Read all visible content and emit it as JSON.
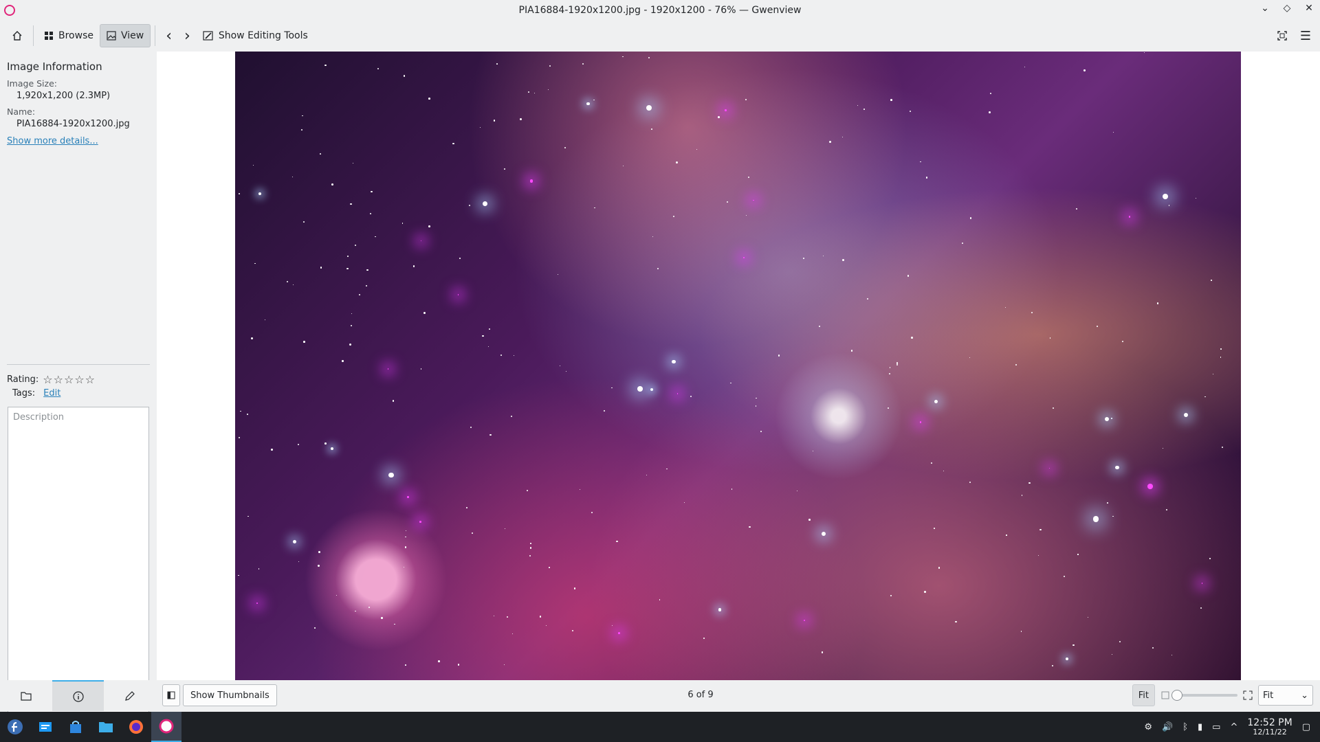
{
  "window": {
    "title": "PIA16884-1920x1200.jpg - 1920x1200 - 76% — Gwenview",
    "controls": [
      "⌄",
      "◇",
      "✕"
    ]
  },
  "toolbar": {
    "home_icon": "home-icon",
    "browse_label": "Browse",
    "view_label": "View",
    "prev_icon": "‹",
    "next_icon": "›",
    "editing_label": "Show Editing Tools",
    "fullscreen_icon": "fullscreen-icon",
    "menu_icon": "☰"
  },
  "sidebar": {
    "heading": "Image Information",
    "size_label": "Image Size:",
    "size_value": "1,920x1,200 (2.3MP)",
    "name_label": "Name:",
    "name_value": "PIA16884-1920x1200.jpg",
    "more_link": "Show more details...",
    "rating_label": "Rating:",
    "rating_stars": "☆☆☆☆☆",
    "rating_value": 0,
    "tags_label": "Tags:",
    "tags_edit": "Edit",
    "description_placeholder": "Description"
  },
  "bottombar": {
    "show_thumbnails": "Show Thumbnails",
    "counter": "6 of 9",
    "fit_button": "Fit",
    "zoom_select": "Fit",
    "zoom_percent": 76
  },
  "taskbar": {
    "time": "12:52 PM",
    "date": "12/11/22"
  },
  "colors": {
    "accent": "#3daee9",
    "link": "#2980b9",
    "taskbar": "#1e2125"
  }
}
